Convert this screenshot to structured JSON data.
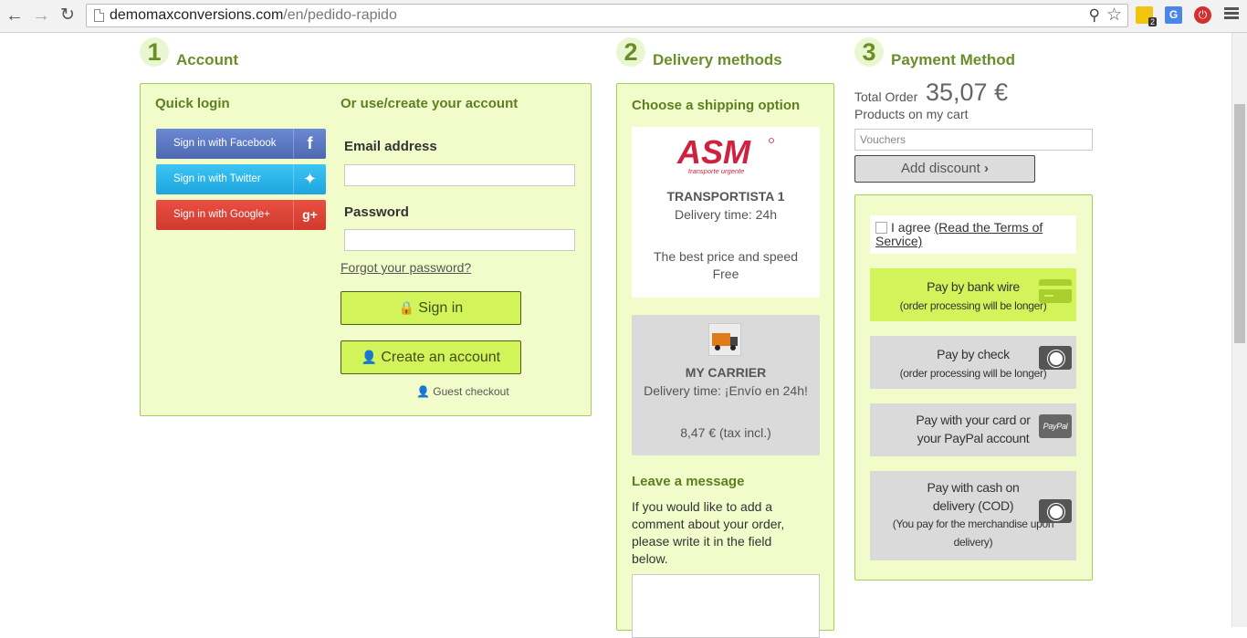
{
  "browser": {
    "url_domain": "demomaxconversions.com",
    "url_path": "/en/pedido-rapido",
    "extension_badge": "2",
    "translate_icon_text": "G"
  },
  "account": {
    "step": "1",
    "title": "Account",
    "quick_login": "Quick login",
    "facebook": "Sign in with Facebook",
    "twitter": "Sign in with Twitter",
    "google": "Sign in with Google+",
    "or_use": "Or use/create your account",
    "email_label": "Email address",
    "email_value": "",
    "password_label": "Password",
    "password_value": "",
    "forgot": "Forgot your password?",
    "sign_in": "Sign in",
    "create": "Create an account",
    "guest": "Guest checkout"
  },
  "delivery": {
    "step": "2",
    "title": "Delivery methods",
    "choose": "Choose a shipping option",
    "options": [
      {
        "logo_text": "ASM",
        "logo_sub": "transporte urgente",
        "name": "TRANSPORTISTA 1",
        "time": "Delivery time: 24h",
        "desc": "The best price and speed",
        "price": "Free"
      },
      {
        "name": "MY CARRIER",
        "time": "Delivery time: ¡Envío en 24h!",
        "price": "8,47 € (tax incl.)"
      }
    ],
    "leave_message": "Leave a message",
    "message_help": "If you would like to add a comment about your order, please write it in the field below."
  },
  "payment": {
    "step": "3",
    "title": "Payment Method",
    "total_label": "Total Order",
    "total_value": "35,07 €",
    "products_label": "Products on my cart",
    "voucher_placeholder": "Vouchers",
    "add_discount": "Add discount",
    "agree": "I agree",
    "terms_link": "(Read the Terms of Service)",
    "methods": [
      {
        "title": "Pay by bank wire",
        "sub": "(order processing will be longer)",
        "icon": "credit-card-icon",
        "selected": true
      },
      {
        "title": "Pay by check",
        "sub": "(order processing will be longer)",
        "icon": "cash-icon",
        "selected": false
      },
      {
        "title": "Pay with your card or your PayPal account",
        "sub": "",
        "icon": "paypal-icon",
        "icon_text": "PayPal",
        "selected": false
      },
      {
        "title": "Pay with cash on delivery (COD)",
        "sub": "(You pay for the merchandise upon delivery)",
        "icon": "cash-icon",
        "selected": false
      }
    ]
  },
  "colors": {
    "accent_green": "#d3f35a",
    "panel_bg": "#f2fccb",
    "panel_border": "#a6cf5a",
    "heading_green": "#6a8f28",
    "facebook": "#5a77c2",
    "twitter": "#27b3e8",
    "google": "#dc4437"
  }
}
